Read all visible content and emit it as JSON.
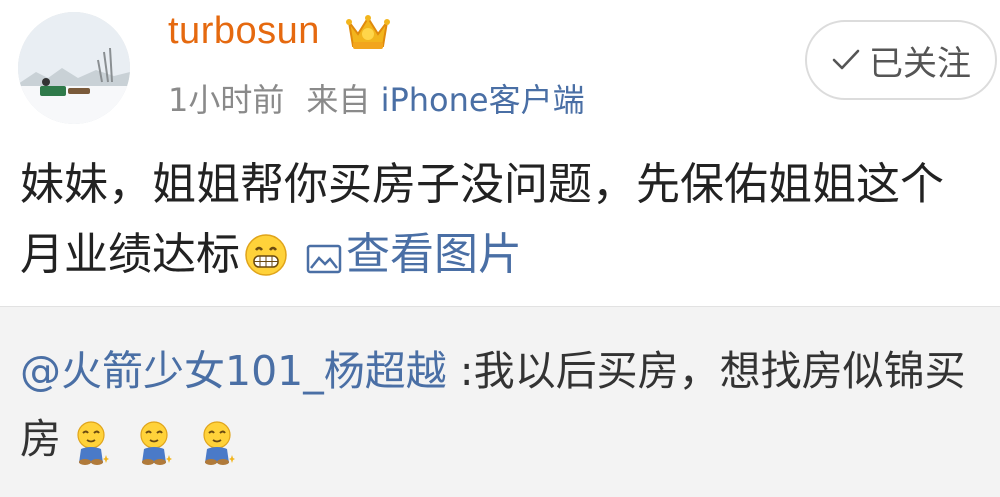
{
  "post": {
    "username": "turbosun",
    "badge_icon": "crown-vip-icon",
    "time": "1小时前",
    "source_prefix": "来自",
    "source_client": "iPhone客户端",
    "follow_label": "已关注",
    "text_part1": "妹妹，姐姐帮你买房子没问题，先保佑姐姐这个月业绩达标",
    "inline_emoji": "grin-emoji-icon",
    "view_image_label": "查看图片"
  },
  "repost": {
    "mention": "@火箭少女101_杨超越",
    "text": " :我以后买房，想找房似锦买房",
    "emoji_count": 3,
    "emoji_icon": "pray-emoji-icon"
  },
  "colors": {
    "username": "#e5690f",
    "link": "#4a6fa5",
    "meta": "#8a8a8a",
    "repost_bg": "#f3f3f3"
  }
}
